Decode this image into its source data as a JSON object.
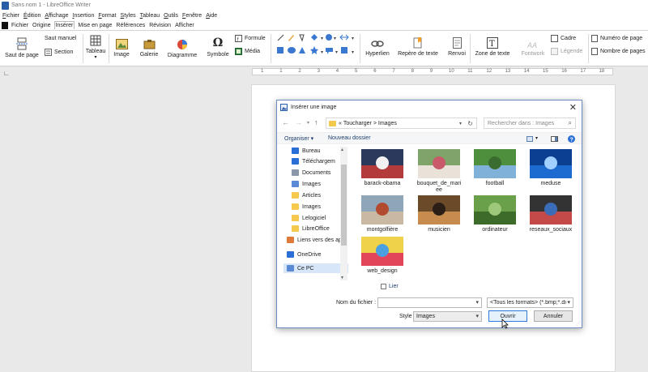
{
  "window": {
    "title": "Sans nom 1 - LibreOffice Writer"
  },
  "menubar": [
    "Fichier",
    "Édition",
    "Affichage",
    "Insertion",
    "Format",
    "Styles",
    "Tableau",
    "Outils",
    "Fenêtre",
    "Aide"
  ],
  "tabs": [
    "Fichier",
    "Origine",
    "Insérer",
    "Mise en page",
    "Références",
    "Révision",
    "Afficher"
  ],
  "ribbon": {
    "saut_de_page": "Saut de page",
    "saut_manuel": "Saut manuel",
    "section": "Section",
    "tableau": "Tableau",
    "image": "Image",
    "galerie": "Galerie",
    "diagramme": "Diagramme",
    "symbole": "Symbole",
    "formule": "Formule",
    "media": "Média",
    "hyperlien": "Hyperlien",
    "repere": "Repère de texte",
    "renvoi": "Renvoi",
    "zone_texte": "Zone de texte",
    "fontwork": "Fontwork",
    "cadre": "Cadre",
    "legende": "Légende",
    "numero_page": "Numéro de page",
    "nombre_pages": "Nombre de pages"
  },
  "ruler_numbers": [
    "1",
    "1",
    "2",
    "3",
    "4",
    "5",
    "6",
    "7",
    "8",
    "9",
    "10",
    "11",
    "12",
    "13",
    "14",
    "15",
    "16",
    "17",
    "18"
  ],
  "dialog": {
    "title": "Insérer une image",
    "breadcrumb": [
      "«",
      "Toucharger",
      ">",
      "Images"
    ],
    "search_placeholder": "Rechercher dans : Images",
    "organiser": "Organiser ▾",
    "nouveau_dossier": "Nouveau dossier",
    "nav_items": [
      {
        "label": "Bureau",
        "icon": "desktop-icon",
        "pinned": true
      },
      {
        "label": "Téléchargem",
        "icon": "download-icon",
        "pinned": true
      },
      {
        "label": "Documents",
        "icon": "documents-icon",
        "pinned": true
      },
      {
        "label": "Images",
        "icon": "pictures-icon",
        "pinned": true
      },
      {
        "label": "Articles",
        "icon": "folder-icon",
        "pinned": false
      },
      {
        "label": "Images",
        "icon": "folder-icon",
        "pinned": false
      },
      {
        "label": "Lelogiciel",
        "icon": "folder-icon",
        "pinned": false
      },
      {
        "label": "LibreOffice",
        "icon": "folder-icon",
        "pinned": false
      },
      {
        "label": "Liens vers des app",
        "icon": "apps-icon",
        "pinned": false
      },
      {
        "label": "OneDrive",
        "icon": "onedrive-icon",
        "pinned": false
      },
      {
        "label": "Ce PC",
        "icon": "pc-icon",
        "pinned": false,
        "selected": true
      }
    ],
    "files": [
      {
        "name": "barack-obama",
        "colors": [
          "#2b3a5c",
          "#b33b3b",
          "#f1f1f1"
        ]
      },
      {
        "name": "bouquet_de_mari\nee",
        "colors": [
          "#7fa46a",
          "#e9e2d9",
          "#c85a6a"
        ]
      },
      {
        "name": "football",
        "colors": [
          "#4e8f3e",
          "#7fb1d9",
          "#3a6b2f"
        ]
      },
      {
        "name": "meduse",
        "colors": [
          "#0b3f8f",
          "#1d6bd1",
          "#9fd0ff"
        ]
      },
      {
        "name": "montgolfière",
        "colors": [
          "#8ea6b8",
          "#c9b8a2",
          "#b24a2f"
        ]
      },
      {
        "name": "musicien",
        "colors": [
          "#6b4a2a",
          "#c78b4e",
          "#2a1e16"
        ]
      },
      {
        "name": "ordinateur",
        "colors": [
          "#6aa04a",
          "#3d6b2a",
          "#9ec87a"
        ]
      },
      {
        "name": "reseaux_sociaux",
        "colors": [
          "#333333",
          "#c44a4a",
          "#3b6cb8"
        ]
      },
      {
        "name": "web_design",
        "colors": [
          "#f0d24a",
          "#e0455a",
          "#4aa0e0"
        ]
      }
    ],
    "lier_label": "Lier",
    "nom_fichier_label": "Nom du fichier :",
    "nom_fichier_value": "",
    "format_value": "<Tous les formats> (*.bmp;*.dx",
    "style_label": "Style",
    "style_value": "Images",
    "ouvrir": "Ouvrir",
    "annuler": "Annuler"
  }
}
